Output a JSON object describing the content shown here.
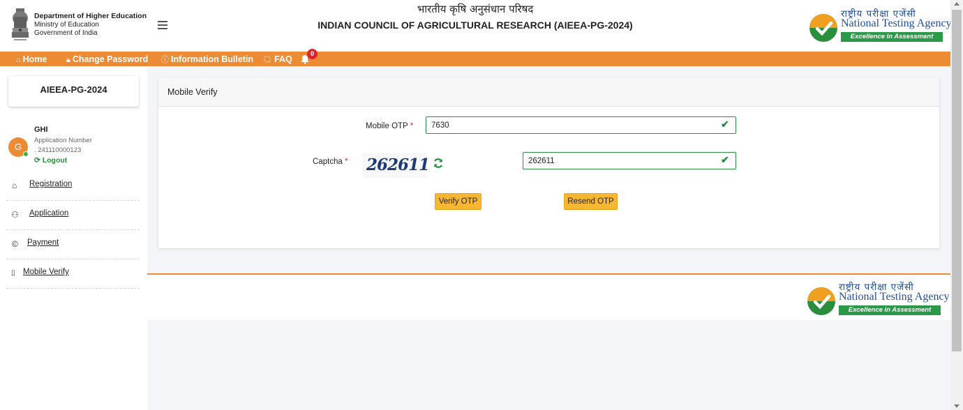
{
  "header": {
    "dept_line1": "Department of Higher Education",
    "dept_line2": "Ministry of Education",
    "dept_line3": "Government of India",
    "title_hindi": "भारतीय कृषि अनुसंधान परिषद",
    "title_english": "INDIAN COUNCIL OF AGRICULTURAL RESEARCH (AIEEA-PG-2024)",
    "nta_hindi": "राष्ट्रीय परीक्षा एजेंसी",
    "nta_english": "National Testing Agency",
    "nta_tagline": "Excellence in Assessment"
  },
  "nav": {
    "home": "Home",
    "change_password": "Change Password",
    "info_bulletin": "Information Bulletin",
    "faq": "FAQ",
    "notification_count": "0"
  },
  "sidebar": {
    "exam": "AIEEA-PG-2024",
    "avatar_letter": "G",
    "user_name": "GHI",
    "app_number_label": "Application Number",
    "app_number": ". 241110000123",
    "logout": "Logout",
    "links": [
      {
        "label": "Registration"
      },
      {
        "label": "Application"
      },
      {
        "label": "Payment"
      },
      {
        "label": "Mobile Verify"
      }
    ]
  },
  "form": {
    "heading": "Mobile Verify",
    "otp_label": "Mobile OTP",
    "otp_value": "7630",
    "captcha_label": "Captcha",
    "captcha_image_text": "262611",
    "captcha_value": "262611",
    "required_mark": "*",
    "verify_button": "Verify OTP",
    "resend_button": "Resend OTP"
  },
  "colors": {
    "accent_orange": "#ec8b33",
    "success_green": "#2a8f3c",
    "button_yellow": "#f7b733",
    "required_red": "#d9262e"
  }
}
